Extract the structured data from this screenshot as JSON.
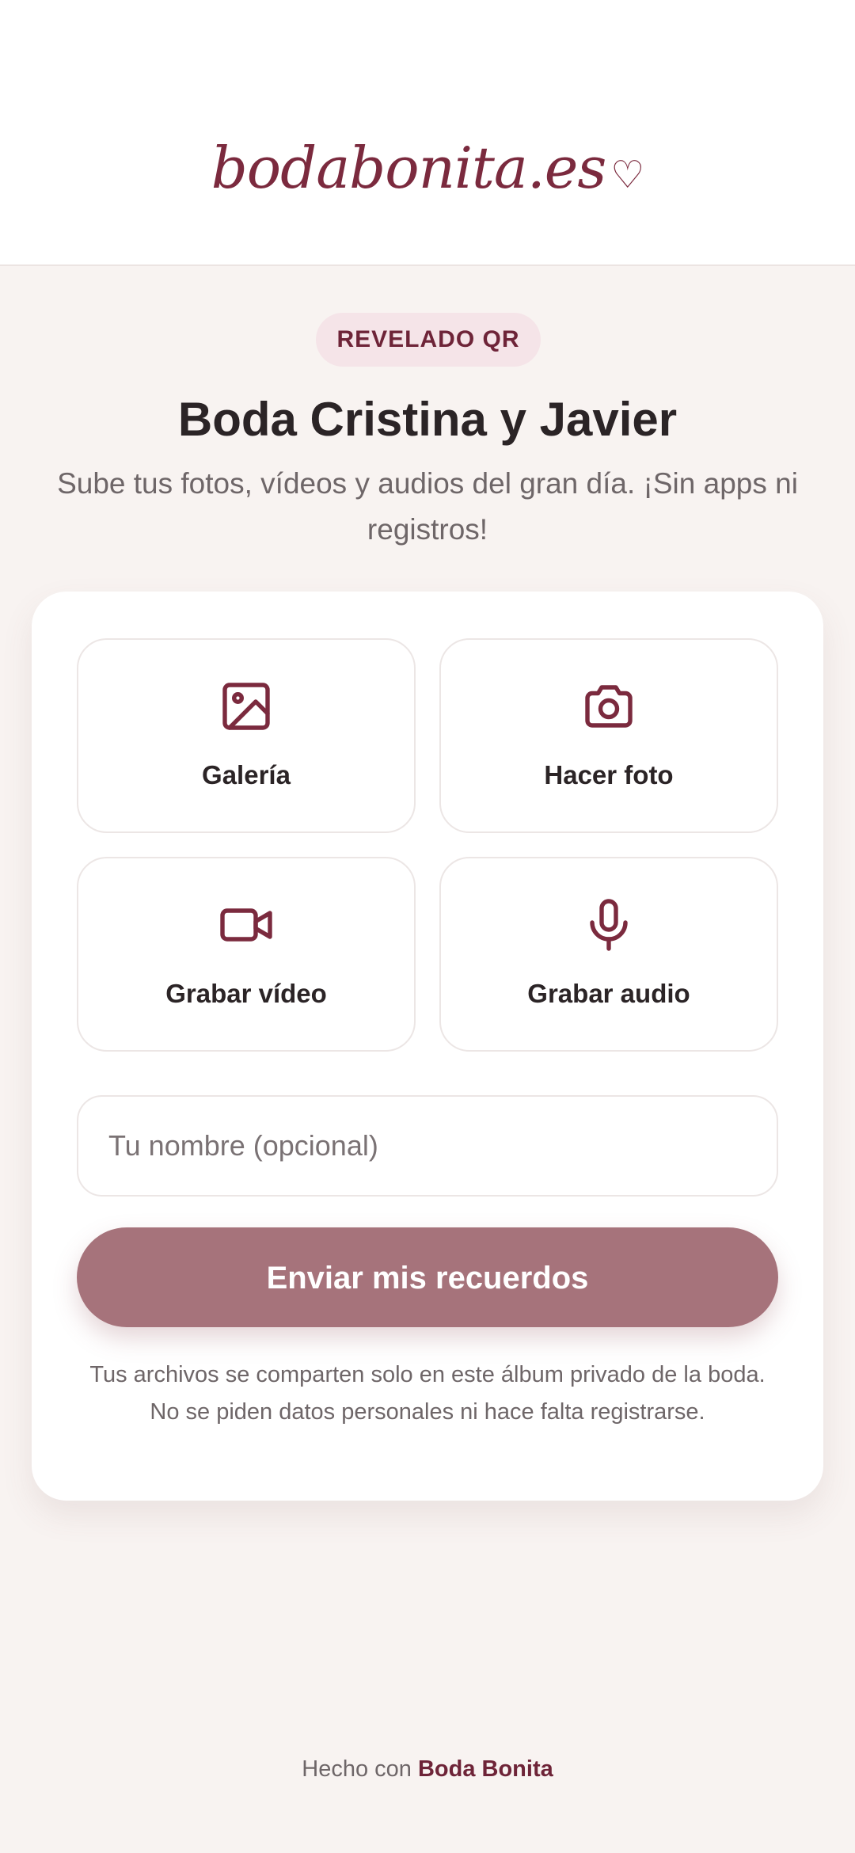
{
  "header": {
    "logo_text": "bodabonita.es",
    "logo_heart": "♡"
  },
  "badge": "REVELADO QR",
  "title": "Boda Cristina y Javier",
  "subtitle": "Sube tus fotos, vídeos y audios del gran día. ¡Sin apps ni registros!",
  "upload_options": {
    "gallery": {
      "label": "Galería",
      "icon": "image-icon"
    },
    "photo": {
      "label": "Hacer foto",
      "icon": "camera-icon"
    },
    "video": {
      "label": "Grabar vídeo",
      "icon": "video-camera-icon"
    },
    "audio": {
      "label": "Grabar audio",
      "icon": "microphone-icon"
    }
  },
  "name_field": {
    "placeholder": "Tu nombre (opcional)",
    "value": ""
  },
  "submit_label": "Enviar mis recuerdos",
  "privacy_note": "Tus archivos se comparten solo en este álbum privado de la boda. No se piden datos personales ni hace falta registrarse.",
  "footer": {
    "prefix": "Hecho con",
    "link": "Boda Bonita"
  },
  "colors": {
    "accent": "#7b2a3e",
    "button": "#a6737b",
    "background": "#f8f3f1",
    "badge_bg": "#f5e4e8"
  }
}
